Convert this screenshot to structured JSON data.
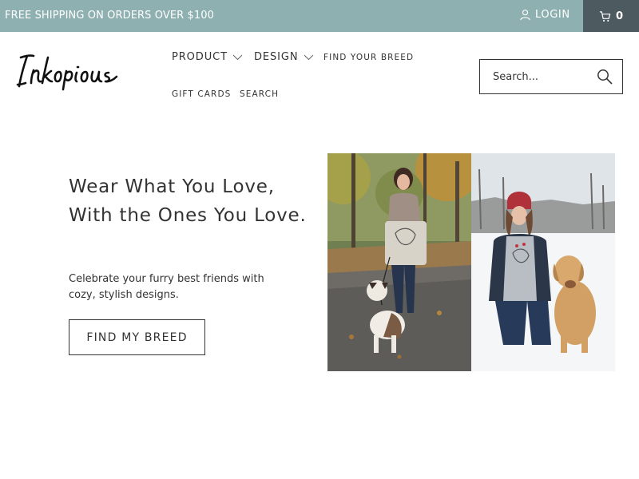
{
  "announcement": {
    "text": "FREE SHIPPING ON ORDERS OVER $100"
  },
  "account": {
    "login_label": "LOGIN",
    "login_icon": "user-icon"
  },
  "cart": {
    "count": "0",
    "icon": "cart-icon"
  },
  "brand": {
    "logo_text": "Inkopious"
  },
  "nav": {
    "product": "PRODUCT",
    "design": "DESIGN",
    "find_breed": "FIND YOUR BREED",
    "gift_cards": "GIFT CARDS",
    "search": "SEARCH"
  },
  "search": {
    "placeholder": "Search...",
    "icon": "search-icon"
  },
  "hero": {
    "title": "Wear What You Love, With the Ones You Love.",
    "subtitle": "Celebrate your furry best friends with cozy, stylish designs.",
    "cta": "FIND MY BREED"
  },
  "colors": {
    "topbar": "#8fb0b0",
    "cart_bg": "#4d5b61",
    "text": "#333333"
  }
}
